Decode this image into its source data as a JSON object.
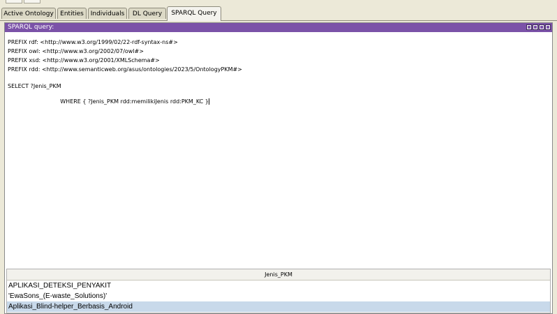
{
  "tabs": [
    "Active Ontology",
    "Entities",
    "Individuals",
    "DL Query",
    "SPARQL Query"
  ],
  "panel": {
    "title": "SPARQL query:"
  },
  "query": {
    "lines": [
      "PREFIX rdf: <http://www.w3.org/1999/02/22-rdf-syntax-ns#>",
      "PREFIX owl: <http://www.w3.org/2002/07/owl#>",
      "PREFIX xsd: <http://www.w3.org/2001/XMLSchema#>",
      "PREFIX rdd: <http://www.semanticweb.org/asus/ontologies/2023/5/OntologyPKM#>",
      "SELECT ?Jenis_PKM",
      "WHERE { ?Jenis_PKM rdd:memilikiJenis rdd:PKM_KC }"
    ]
  },
  "results": {
    "column": "Jenis_PKM",
    "rows": [
      "APLIKASI_DETEKSI_PENYAKIT",
      "'EwaSons_(E-waste_Solutions)'",
      "Aplikasi_Blind-helper_Berbasis_Android"
    ],
    "selected_index": 2
  },
  "colors": {
    "header": "#7b52a8",
    "selected_row": "#c8d9ea"
  }
}
